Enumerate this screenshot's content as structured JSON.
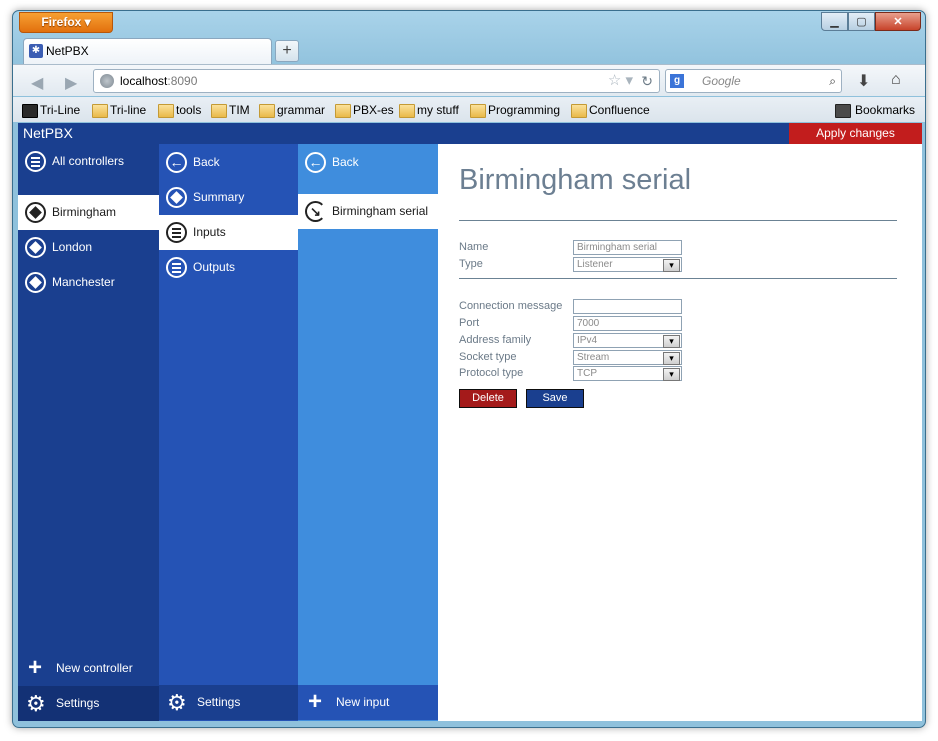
{
  "browser": {
    "menu_button": "Firefox",
    "tab_title": "NetPBX",
    "url_host": "localhost",
    "url_port": ":8090",
    "search_placeholder": "Google",
    "bookmarks": [
      "Tri-Line",
      "Tri-line",
      "tools",
      "TIM",
      "grammar",
      "PBX-es",
      "my stuff",
      "Programming",
      "Confluence"
    ],
    "bookmarks_menu": "Bookmarks"
  },
  "app": {
    "title": "NetPBX",
    "apply_label": "Apply changes"
  },
  "controllers": {
    "header": "All controllers",
    "items": [
      "Birmingham",
      "London",
      "Manchester"
    ],
    "active": "Birmingham",
    "new_label": "New controller",
    "settings_label": "Settings"
  },
  "controller_menu": {
    "back": "Back",
    "items": [
      "Summary",
      "Inputs",
      "Outputs"
    ],
    "active": "Inputs",
    "settings_label": "Settings"
  },
  "inputs": {
    "back": "Back",
    "items": [
      "Birmingham serial"
    ],
    "new_label": "New input"
  },
  "detail": {
    "title": "Birmingham serial",
    "fields": {
      "name_label": "Name",
      "name_value": "Birmingham serial",
      "type_label": "Type",
      "type_value": "Listener",
      "connection_message_label": "Connection message",
      "connection_message_value": "",
      "port_label": "Port",
      "port_value": "7000",
      "address_family_label": "Address family",
      "address_family_value": "IPv4",
      "socket_type_label": "Socket type",
      "socket_type_value": "Stream",
      "protocol_type_label": "Protocol type",
      "protocol_type_value": "TCP"
    },
    "delete_label": "Delete",
    "save_label": "Save"
  },
  "colors": {
    "column1": "#1a3f8f",
    "column2": "#2553b5",
    "column3": "#3f8ddd",
    "apply": "#c21d1d",
    "delete": "#a41a1a"
  }
}
